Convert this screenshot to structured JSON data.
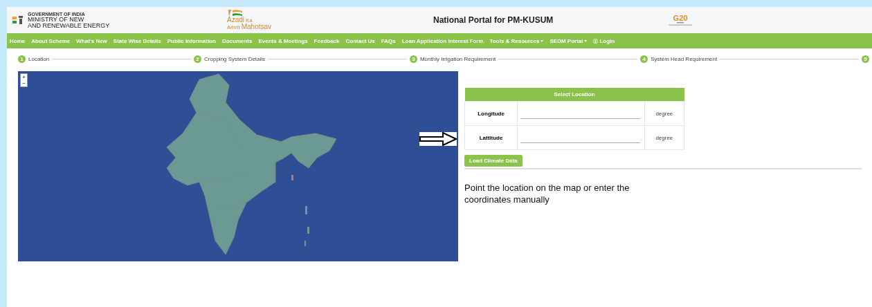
{
  "header": {
    "ministry_small": "GOVERNMENT OF INDIA",
    "ministry_line1": "MINISTRY OF NEW",
    "ministry_line2": "AND RENEWABLE ENERGY",
    "azadi": [
      "Azadi",
      "Ka",
      "Amrit",
      "Mahotsav"
    ],
    "title": "National Portal for PM-KUSUM",
    "g20": "G20"
  },
  "nav": [
    {
      "label": "Home",
      "kind": "link"
    },
    {
      "label": "About Scheme",
      "kind": "link"
    },
    {
      "label": "What's New",
      "kind": "link"
    },
    {
      "label": "State Wise Details",
      "kind": "link"
    },
    {
      "label": "Public Information",
      "kind": "link"
    },
    {
      "label": "Documents",
      "kind": "link"
    },
    {
      "label": "Events & Meetings",
      "kind": "link"
    },
    {
      "label": "Feedback",
      "kind": "link"
    },
    {
      "label": "Contact Us",
      "kind": "link"
    },
    {
      "label": "FAQs",
      "kind": "link"
    },
    {
      "label": "Loan Application Interest Form",
      "kind": "link"
    },
    {
      "label": "Tools & Resources",
      "kind": "dropdown"
    },
    {
      "label": "SEDM Portal",
      "kind": "dropdown"
    },
    {
      "label": "Login",
      "kind": "login"
    }
  ],
  "steps": [
    {
      "number": "1",
      "label": "Location"
    },
    {
      "number": "2",
      "label": "Cropping System Details"
    },
    {
      "number": "3",
      "label": "Monthly Irrigation Requirement"
    },
    {
      "number": "4",
      "label": "System Head Requirement"
    },
    {
      "number": "5"
    }
  ],
  "map": {
    "zoom_in": "+",
    "zoom_out": "−"
  },
  "location_table": {
    "title": "Select Location",
    "rows": [
      {
        "label": "Longitude",
        "unit": "degree"
      },
      {
        "label": "Lattitude",
        "unit": "degree"
      }
    ]
  },
  "load_button": "Load Climate Data",
  "instruction": "Point the location on the map or enter the coordinates manually"
}
